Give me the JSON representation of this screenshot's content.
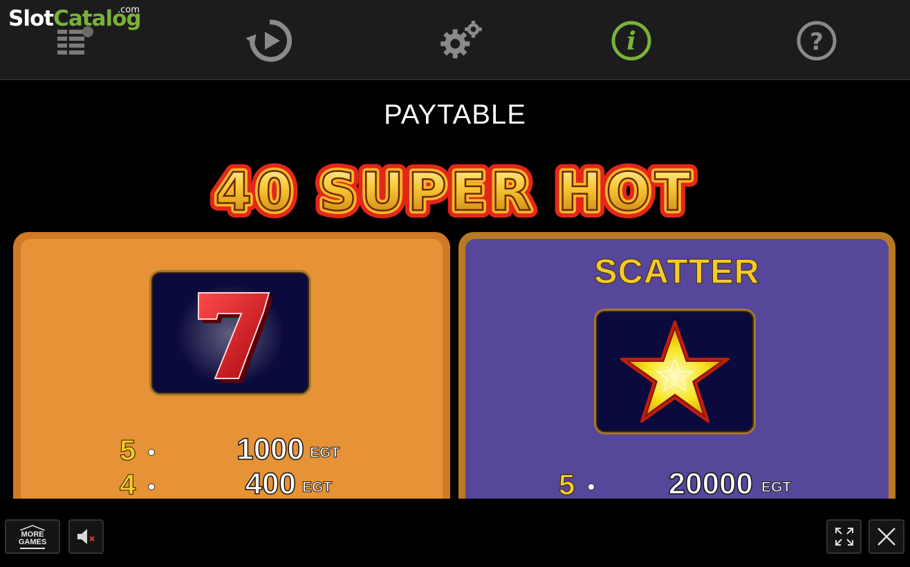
{
  "watermark": {
    "brand_part1": "Slot",
    "brand_part2": "Catalog",
    "brand_suffix": ".com"
  },
  "nav": {
    "items": [
      {
        "icon": "paytable-list-icon"
      },
      {
        "icon": "history-replay-icon"
      },
      {
        "icon": "settings-gears-icon"
      },
      {
        "icon": "info-icon",
        "active": true,
        "active_color": "#7ab23a"
      },
      {
        "icon": "help-question-icon"
      }
    ]
  },
  "page": {
    "heading": "PAYTABLE",
    "game_title": "40 SUPER HOT"
  },
  "panels": {
    "seven": {
      "symbol": "red-seven",
      "bg_color": "#e69236",
      "payouts": [
        {
          "count": "5",
          "amount": "1000",
          "unit": "EGT"
        },
        {
          "count": "4",
          "amount": "400",
          "unit": "EGT"
        }
      ]
    },
    "scatter": {
      "title": "SCATTER",
      "symbol": "yellow-star",
      "bg_color": "#57479a",
      "payouts": [
        {
          "count": "5",
          "amount": "20000",
          "unit": "EGT"
        }
      ]
    }
  },
  "footer": {
    "more_games_line1": "MORE",
    "more_games_line2": "GAMES",
    "sound_state": "muted"
  }
}
